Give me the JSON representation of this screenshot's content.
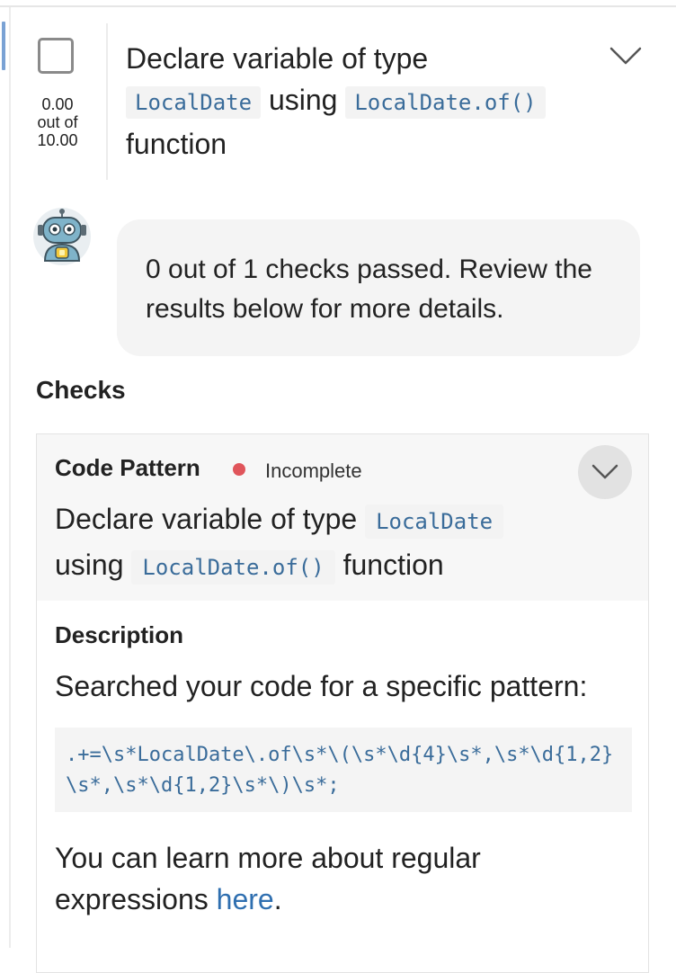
{
  "task": {
    "checkbox_checked": false,
    "score": {
      "value": "0.00",
      "out_of_label": "out of",
      "max": "10.00"
    },
    "title_prefix": "Declare variable of type",
    "title_code_type": "LocalDate",
    "title_middle": "using",
    "title_code_call": "LocalDate.of()",
    "title_suffix": "function",
    "expand_icon": "chevron-down-icon"
  },
  "assistant": {
    "avatar_icon": "robot-icon",
    "message": "0 out of 1 checks passed. Review the results below for more details."
  },
  "checks": {
    "heading": "Checks",
    "items": [
      {
        "type": "Code Pattern",
        "status": "Incomplete",
        "status_color": "#e0555b",
        "title_prefix": "Declare variable of type",
        "title_code_type": "LocalDate",
        "title_middle": "using",
        "title_code_call": "LocalDate.of()",
        "title_suffix": "function",
        "description_heading": "Description",
        "description_text": "Searched your code for a specific pattern:",
        "pattern": ".+=\\s*LocalDate\\.of\\s*\\(\\s*\\d{4}\\s*,\\s*\\d{1,2}\\s*,\\s*\\d{1,2}\\s*\\)\\s*;",
        "learn_prefix": "You can learn more about regular expressions",
        "learn_link": "here",
        "learn_suffix": "."
      }
    ]
  },
  "colors": {
    "code_text": "#3a6c9a",
    "link": "#2f6fb0",
    "accent": "#7aa2d4"
  }
}
